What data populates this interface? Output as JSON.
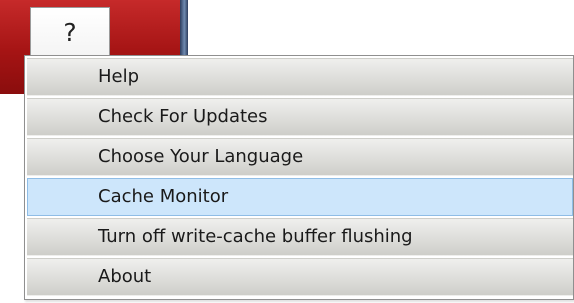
{
  "help_tab": {
    "label": "?"
  },
  "menu": {
    "items": [
      {
        "label": "Help",
        "state": "normal"
      },
      {
        "label": "Check For Updates",
        "state": "normal"
      },
      {
        "label": "Choose Your Language",
        "state": "normal"
      },
      {
        "label": "Cache Monitor",
        "state": "hovered"
      },
      {
        "label": "Turn off write-cache buffer flushing",
        "state": "normal"
      },
      {
        "label": "About",
        "state": "normal"
      }
    ]
  },
  "colors": {
    "background_red": "#a51414",
    "menu_item_gray": "#dfdfdc",
    "hover_blue": "#cde6fb",
    "hover_border": "#8fbde6"
  }
}
